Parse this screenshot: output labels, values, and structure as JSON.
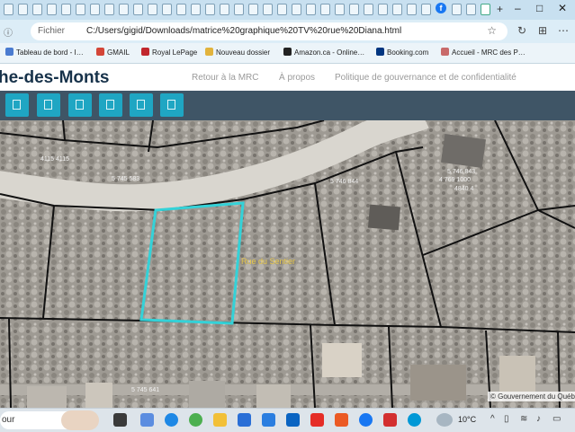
{
  "browser": {
    "window_buttons": [
      "–",
      "□",
      "✕"
    ],
    "address": {
      "info_icon": "info-icon",
      "file_label": "Fichier",
      "url": "C:/Users/gigid/Downloads/matrice%20graphique%20TV%20rue%20Diana.html"
    },
    "bookmarks": [
      {
        "label": "Tableau de bord - I…",
        "color": "#4a7bd0"
      },
      {
        "label": "GMAIL",
        "color": "#d44638"
      },
      {
        "label": "Royal LePage",
        "color": "#c1272d"
      },
      {
        "label": "Nouveau dossier",
        "color": "#e2b33c"
      },
      {
        "label": "Amazon.ca - Online…",
        "color": "#222222"
      },
      {
        "label": "Booking.com",
        "color": "#003580"
      },
      {
        "label": "Accueil - MRC des P…",
        "color": "#c86a6a"
      }
    ]
  },
  "site": {
    "title": "he-des-Monts",
    "nav": [
      "Retour à la MRC",
      "À propos",
      "Politique de gouvernance et de confidentialité"
    ],
    "toolbar_count": 6
  },
  "map": {
    "parcel_labels": [
      {
        "text": "5 745 583",
        "id": "p1"
      },
      {
        "text": "5 746 843",
        "id": "p2"
      },
      {
        "text": "4 769 1000",
        "id": "p3"
      },
      {
        "text": "4840 4",
        "id": "p4"
      },
      {
        "text": "5 745 641",
        "id": "p5"
      },
      {
        "text": "5 746 844",
        "id": "p6"
      },
      {
        "text": "4115 4115",
        "id": "p7"
      }
    ],
    "street_label": "Rue du Sentier",
    "copyright": "© Gouvernement du Québec",
    "colors": {
      "selection": "#34d2d8",
      "parcel_line": "#111111"
    }
  },
  "taskbar": {
    "search_text": "our",
    "temperature": "10°C",
    "tray_chevron": "^"
  }
}
